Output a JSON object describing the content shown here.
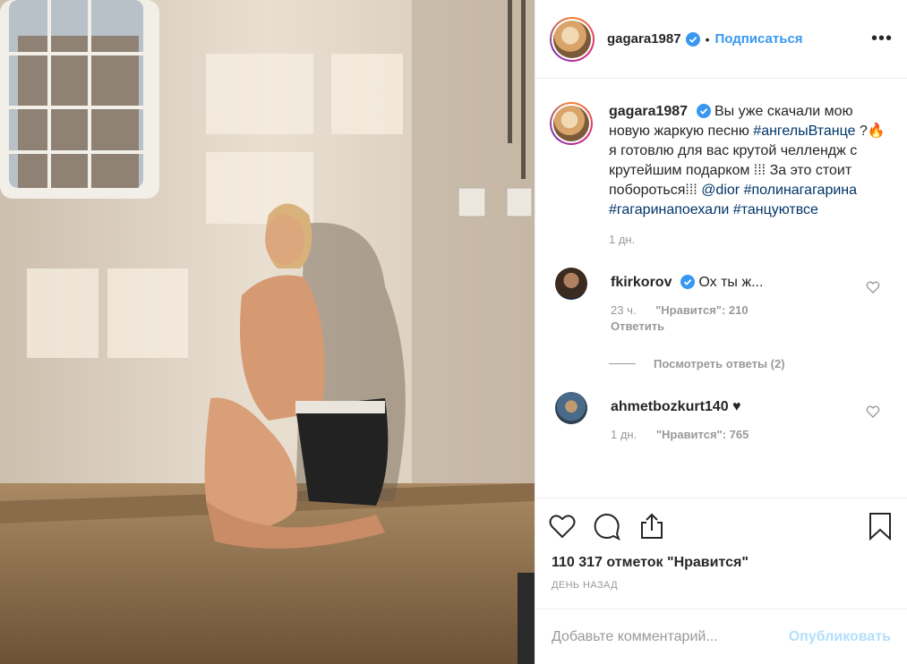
{
  "post": {
    "author": "gagara1987",
    "follow_label": "Подписаться",
    "separator": "•",
    "more_label": "•••"
  },
  "caption": {
    "username": "gagara1987",
    "text_before_tag": "Вы уже скачали мою новую жаркую песню ",
    "tag1": "#ангелыВтанце",
    "text_middle": " ?🔥 я готовлю для вас крутой челлендж с крутейшим подарком ⁞⁞⁞ За это стоит побороться⁞⁞⁞ ",
    "mention": "@dior",
    "tag2": "#полинагагарина",
    "tag3": "#гагаринапоехали",
    "tag4": "#танцуютвсе",
    "time": "1 дн."
  },
  "comments": [
    {
      "username": "fkirkorov",
      "text": "Ох ты ж...",
      "time": "23 ч.",
      "likes": "\"Нравится\": 210",
      "reply": "Ответить"
    },
    {
      "username": "ahmetbozkurt140",
      "text": "♥",
      "time": "1 дн.",
      "likes": "\"Нравится\": 765"
    }
  ],
  "view_replies": "Посмотреть ответы (2)",
  "likes_text": "110 317 отметок \"Нравится\"",
  "date_text": "ДЕНЬ НАЗАД",
  "add_comment": {
    "placeholder": "Добавьте комментарий...",
    "publish_label": "Опубликовать"
  },
  "colors": {
    "link_blue": "#3897f0",
    "tag_blue": "#003569",
    "muted": "#999999",
    "publish_disabled": "#b2dffc"
  }
}
